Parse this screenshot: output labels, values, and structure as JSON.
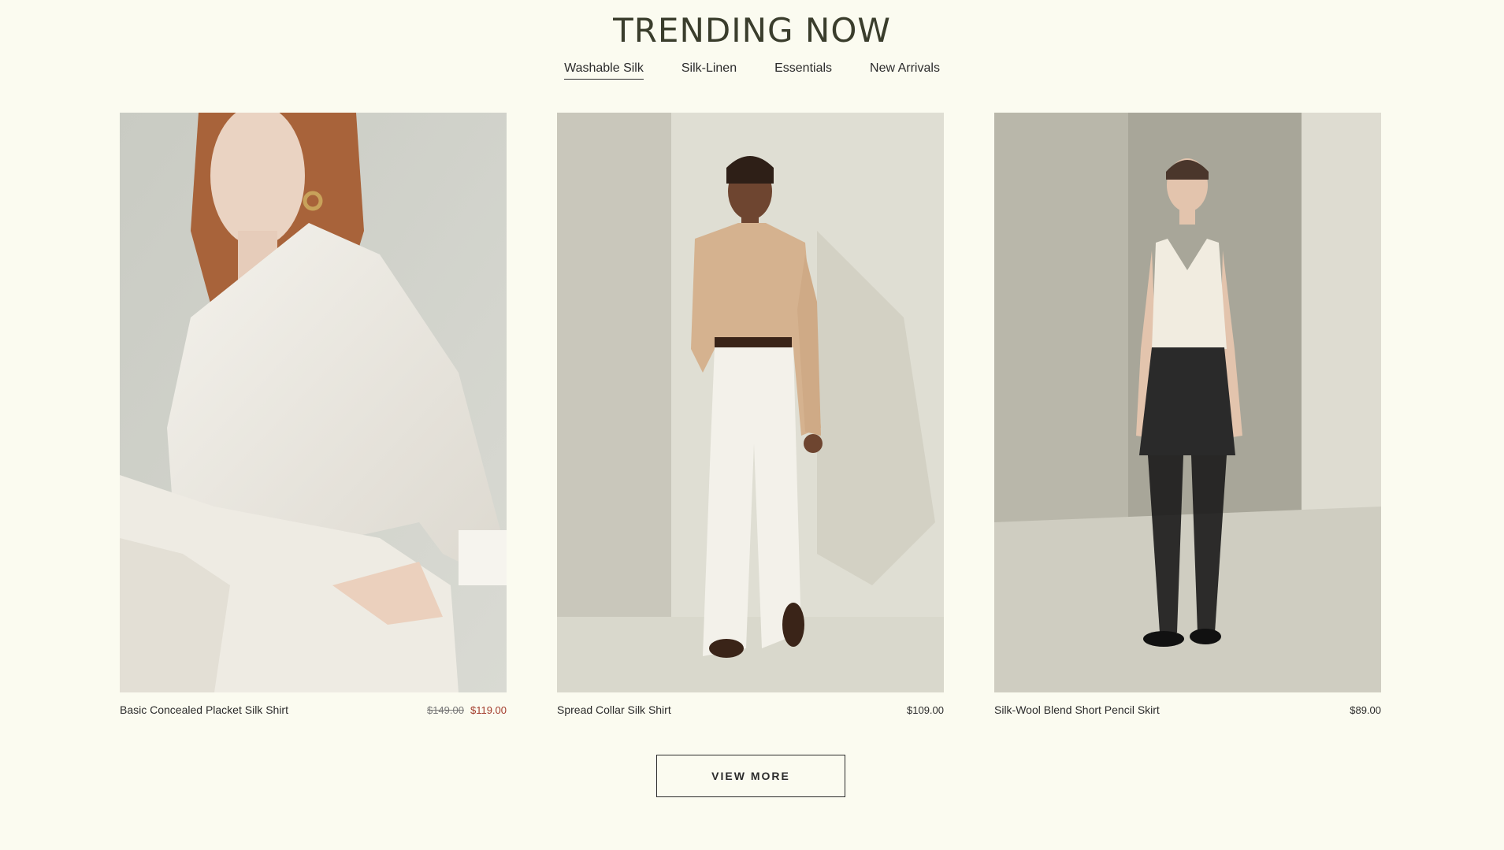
{
  "section": {
    "title": "TRENDING NOW"
  },
  "tabs": [
    {
      "label": "Washable Silk",
      "active": true
    },
    {
      "label": "Silk-Linen",
      "active": false
    },
    {
      "label": "Essentials",
      "active": false
    },
    {
      "label": "New Arrivals",
      "active": false
    }
  ],
  "products": [
    {
      "name": "Basic Concealed Placket Silk Shirt",
      "price_original": "$149.00",
      "price_sale": "$119.00"
    },
    {
      "name": "Spread Collar Silk Shirt",
      "price": "$109.00"
    },
    {
      "name": "Silk-Wool Blend Short Pencil Skirt",
      "price": "$89.00"
    }
  ],
  "view_more_label": "VIEW MORE",
  "colors": {
    "background": "#fbfbf0",
    "title": "#3a3d2c",
    "sale": "#a23a2a"
  }
}
